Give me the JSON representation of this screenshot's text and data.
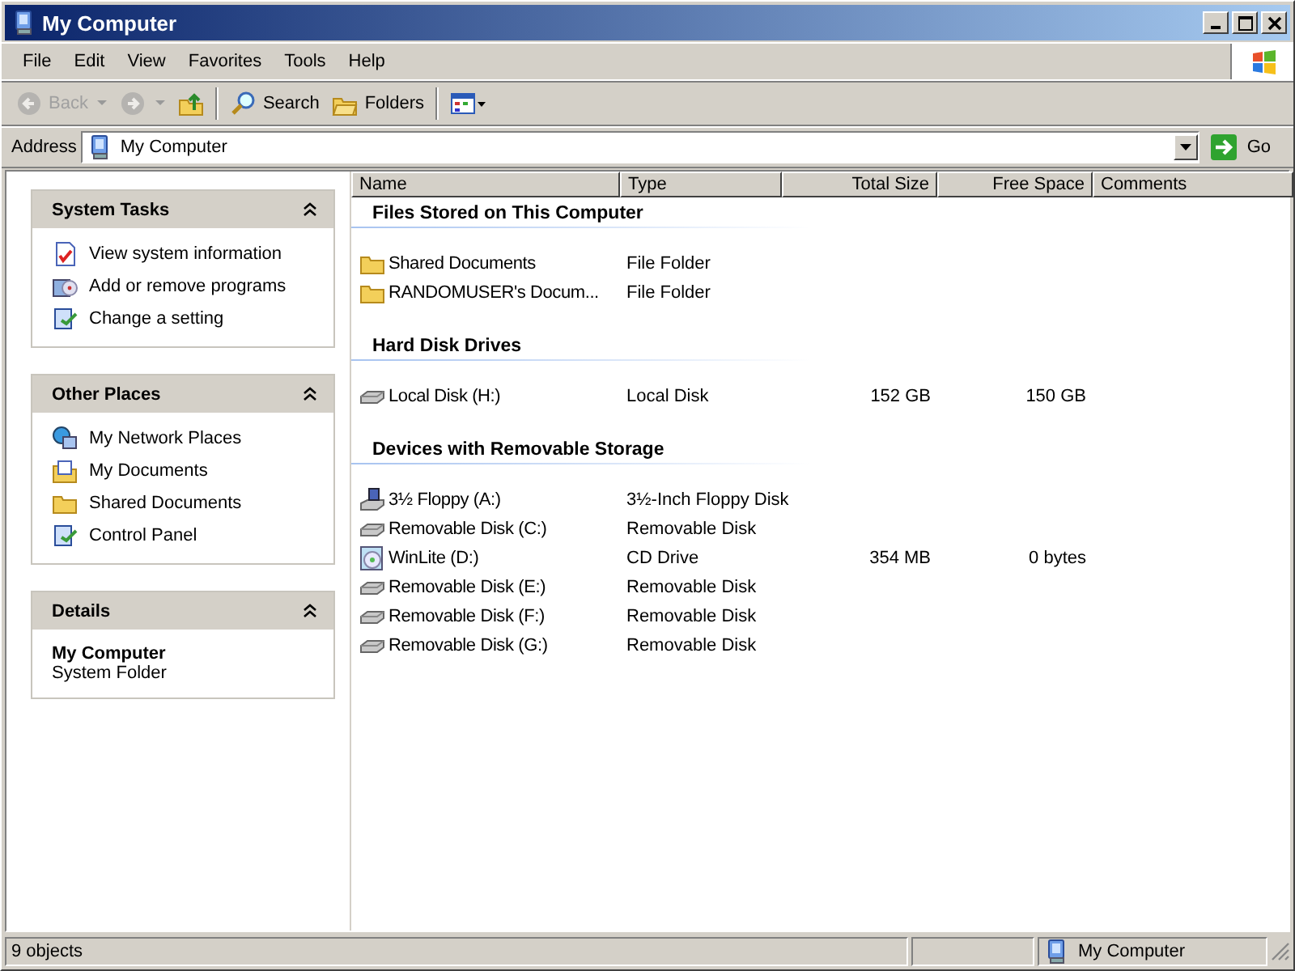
{
  "window": {
    "title": "My Computer"
  },
  "menu": [
    {
      "label": "File"
    },
    {
      "label": "Edit"
    },
    {
      "label": "View"
    },
    {
      "label": "Favorites"
    },
    {
      "label": "Tools"
    },
    {
      "label": "Help"
    }
  ],
  "toolbar": [
    {
      "kind": "back",
      "label": "Back",
      "disabled": true
    },
    {
      "kind": "forward",
      "disabled": true
    },
    {
      "kind": "up",
      "disabled": false
    },
    {
      "kind": "search",
      "label": "Search",
      "disabled": false
    },
    {
      "kind": "folders",
      "label": "Folders",
      "disabled": false
    },
    {
      "kind": "views",
      "disabled": false
    }
  ],
  "address": {
    "label": "Address",
    "value": "My Computer",
    "go": "Go"
  },
  "panels": [
    {
      "title": "System Tasks",
      "expanded": true,
      "items": [
        {
          "kind": "sysinfo",
          "label": "View system information"
        },
        {
          "kind": "addremove",
          "label": "Add or remove programs"
        },
        {
          "kind": "setting",
          "label": "Change a setting"
        }
      ]
    },
    {
      "title": "Other Places",
      "expanded": true,
      "items": [
        {
          "kind": "network",
          "label": "My Network Places"
        },
        {
          "kind": "mydocs",
          "label": "My Documents"
        },
        {
          "kind": "folder",
          "label": "Shared Documents"
        },
        {
          "kind": "setting",
          "label": "Control Panel"
        }
      ]
    }
  ],
  "details": {
    "title": "Details",
    "expanded": true,
    "name": "My Computer",
    "type": "System Folder"
  },
  "columns": [
    "Name",
    "Type",
    "Total Size",
    "Free Space",
    "Comments"
  ],
  "groups": [
    {
      "title": "Files Stored on This Computer",
      "items": [
        {
          "kind": "folder",
          "name": "Shared Documents",
          "type": "File Folder"
        },
        {
          "kind": "folder",
          "name": "RANDOMUSER's Docum...",
          "type": "File Folder"
        }
      ]
    },
    {
      "title": "Hard Disk Drives",
      "items": [
        {
          "kind": "disk",
          "name": "Local Disk (H:)",
          "type": "Local Disk",
          "total": "152 GB",
          "free": "150 GB"
        }
      ]
    },
    {
      "title": "Devices with Removable Storage",
      "items": [
        {
          "kind": "floppy",
          "name": "3½ Floppy (A:)",
          "type": "3½-Inch Floppy Disk"
        },
        {
          "kind": "disk",
          "name": "Removable Disk (C:)",
          "type": "Removable Disk"
        },
        {
          "kind": "cd",
          "name": "WinLite (D:)",
          "type": "CD Drive",
          "total": "354 MB",
          "free": "0 bytes"
        },
        {
          "kind": "disk",
          "name": "Removable Disk (E:)",
          "type": "Removable Disk"
        },
        {
          "kind": "disk",
          "name": "Removable Disk (F:)",
          "type": "Removable Disk"
        },
        {
          "kind": "disk",
          "name": "Removable Disk (G:)",
          "type": "Removable Disk"
        }
      ]
    }
  ],
  "status": {
    "count": "9 objects",
    "location": "My Computer"
  }
}
